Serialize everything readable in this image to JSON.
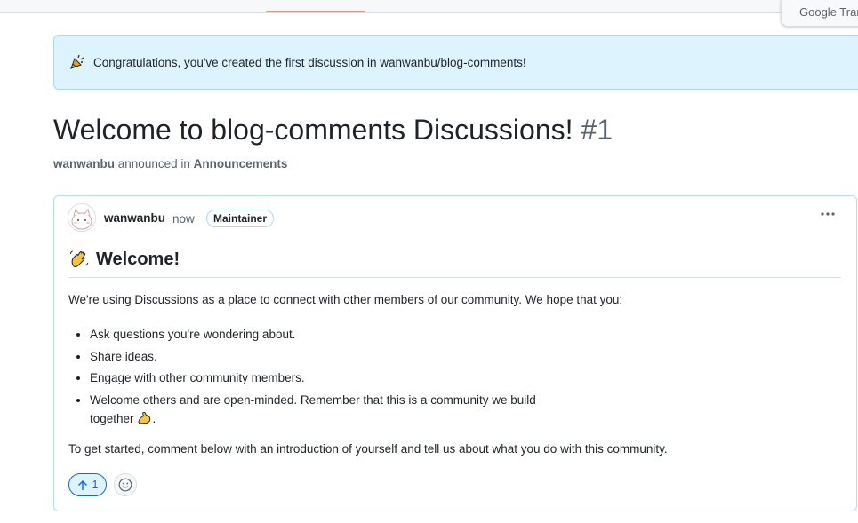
{
  "flash": {
    "message": "Congratulations, you've created the first discussion in wanwanbu/blog-comments!",
    "icon": "party-popper-icon"
  },
  "widget": {
    "label": "Google Trans"
  },
  "discussion": {
    "title": "Welcome to blog-comments Discussions!",
    "number": "#1",
    "meta": {
      "author": "wanwanbu",
      "verb": "announced in",
      "category": "Announcements"
    }
  },
  "post": {
    "author": "wanwanbu",
    "time": "now",
    "badge": "Maintainer",
    "heading": "Welcome!",
    "intro": "We're using Discussions as a place to connect with other members of our community. We hope that you:",
    "bullets": [
      "Ask questions you're wondering about.",
      "Share ideas.",
      "Engage with other community members.",
      "Welcome others and are open-minded. Remember that this is a community we build together",
      "."
    ],
    "outro": "To get started, comment below with an introduction of yourself and tell us about what you do with this community.",
    "upvotes": "1"
  },
  "colors": {
    "accent": "#0969da",
    "flash_bg": "#ddf4ff",
    "tab_underline": "#fd8c73"
  }
}
